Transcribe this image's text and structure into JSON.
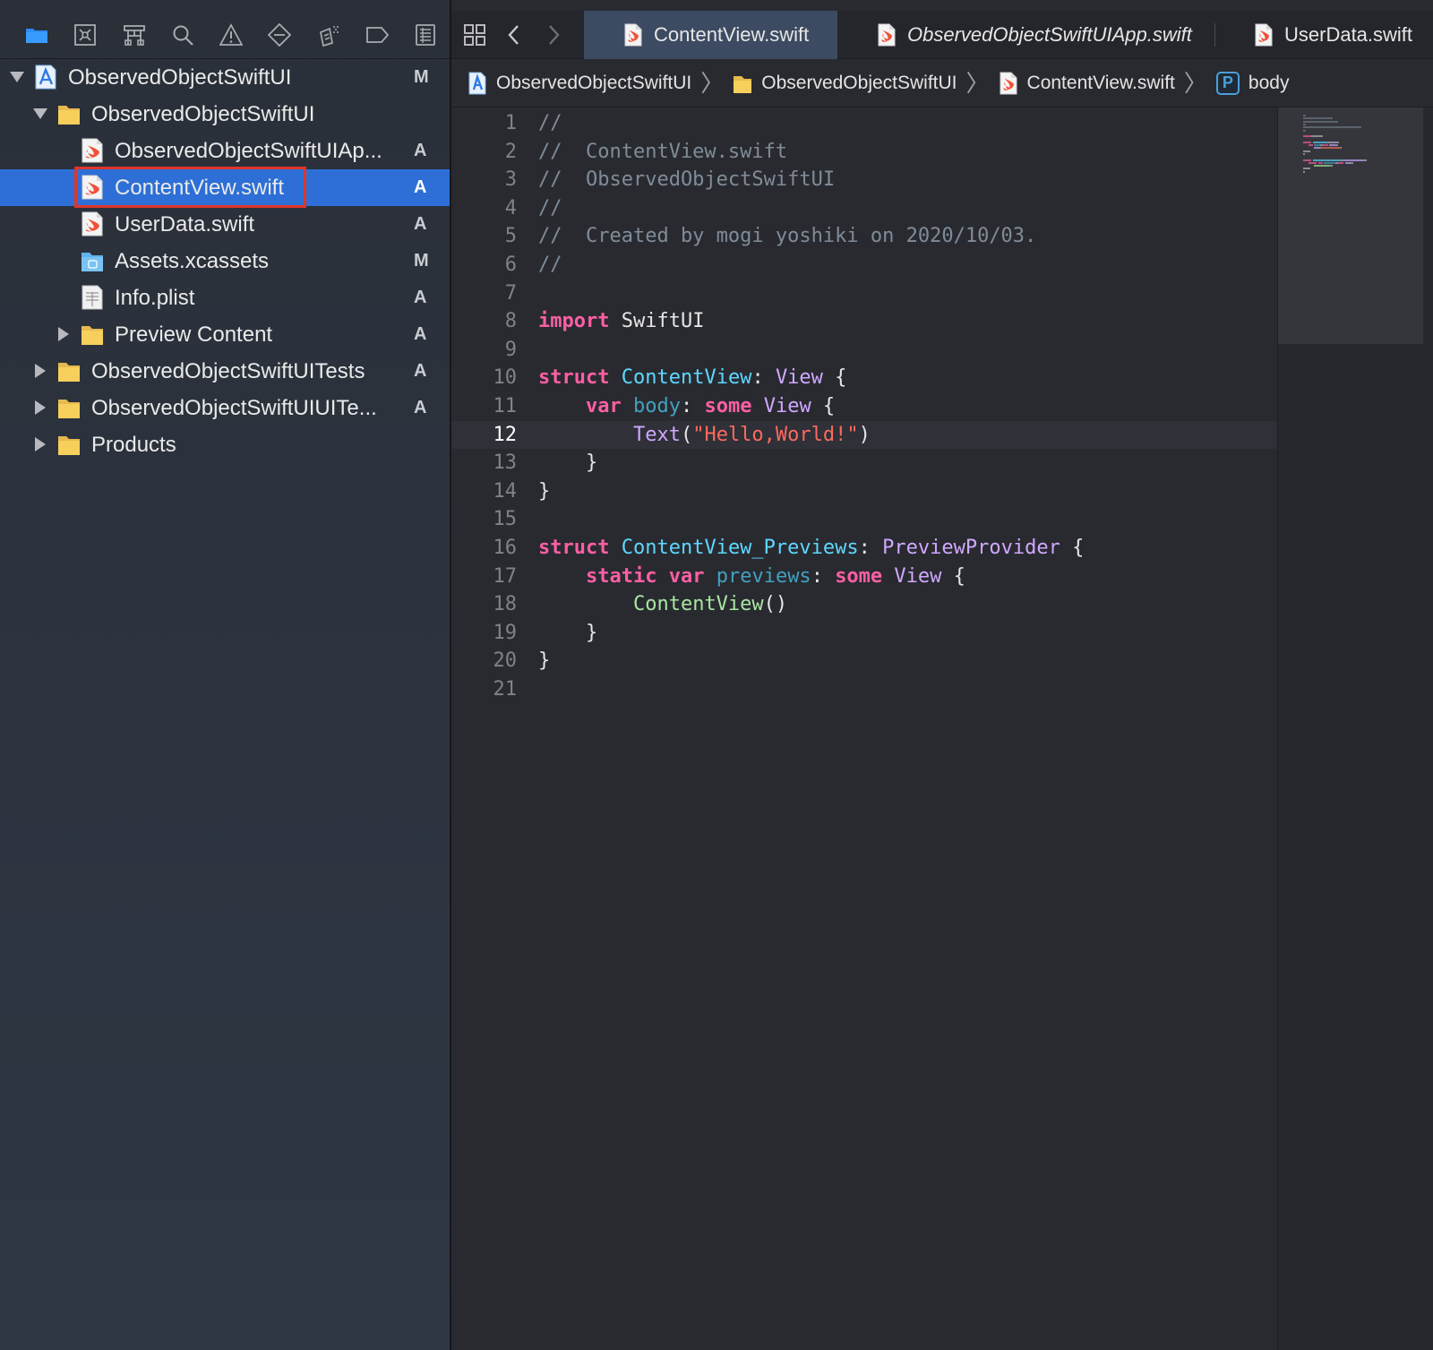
{
  "navigator": {
    "toolbar": [
      "project-navigator-icon",
      "source-control-icon",
      "symbol-navigator-icon",
      "find-icon",
      "issue-icon",
      "test-icon",
      "debug-icon",
      "breakpoint-icon",
      "report-icon"
    ],
    "tree": [
      {
        "label": "ObservedObjectSwiftUI",
        "status": "M",
        "type": "project",
        "indent": 0,
        "disclosure": "open"
      },
      {
        "label": "ObservedObjectSwiftUI",
        "status": "",
        "type": "folder",
        "indent": 1,
        "disclosure": "open"
      },
      {
        "label": "ObservedObjectSwiftUIAp...",
        "status": "A",
        "type": "swift",
        "indent": 2,
        "disclosure": "none"
      },
      {
        "label": "ContentView.swift",
        "status": "A",
        "type": "swift",
        "indent": 2,
        "disclosure": "none",
        "selected": true
      },
      {
        "label": "UserData.swift",
        "status": "A",
        "type": "swift",
        "indent": 2,
        "disclosure": "none"
      },
      {
        "label": "Assets.xcassets",
        "status": "M",
        "type": "assets",
        "indent": 2,
        "disclosure": "none"
      },
      {
        "label": "Info.plist",
        "status": "A",
        "type": "plist",
        "indent": 2,
        "disclosure": "none"
      },
      {
        "label": "Preview Content",
        "status": "A",
        "type": "folder",
        "indent": 2,
        "disclosure": "closed"
      },
      {
        "label": "ObservedObjectSwiftUITests",
        "status": "A",
        "type": "folder",
        "indent": 1,
        "disclosure": "closed"
      },
      {
        "label": "ObservedObjectSwiftUIUITe...",
        "status": "A",
        "type": "folder",
        "indent": 1,
        "disclosure": "closed"
      },
      {
        "label": "Products",
        "status": "",
        "type": "folder",
        "indent": 1,
        "disclosure": "closed"
      }
    ]
  },
  "tabs": [
    {
      "label": "ContentView.swift",
      "active": true,
      "italic": false
    },
    {
      "label": "ObservedObjectSwiftUIApp.swift",
      "active": false,
      "italic": true
    },
    {
      "label": "UserData.swift",
      "active": false,
      "italic": false
    }
  ],
  "breadcrumb": [
    {
      "label": "ObservedObjectSwiftUI",
      "icon": "project-icon"
    },
    {
      "label": "ObservedObjectSwiftUI",
      "icon": "folder-icon"
    },
    {
      "label": "ContentView.swift",
      "icon": "swift-file-icon"
    },
    {
      "label": "body",
      "icon": "property-icon",
      "badge": "P"
    }
  ],
  "editor": {
    "current_line": 12,
    "lines": [
      [
        [
          "cm",
          "//"
        ]
      ],
      [
        [
          "cm",
          "//  ContentView.swift"
        ]
      ],
      [
        [
          "cm",
          "//  ObservedObjectSwiftUI"
        ]
      ],
      [
        [
          "cm",
          "//"
        ]
      ],
      [
        [
          "cm",
          "//  Created by mogi yoshiki on 2020/10/03."
        ]
      ],
      [
        [
          "cm",
          "//"
        ]
      ],
      [],
      [
        [
          "kw",
          "import"
        ],
        [
          "",
          " SwiftUI"
        ]
      ],
      [],
      [
        [
          "kw",
          "struct"
        ],
        [
          "",
          " "
        ],
        [
          "ty",
          "ContentView"
        ],
        [
          "",
          ": "
        ],
        [
          "st",
          "View"
        ],
        [
          "",
          " {"
        ]
      ],
      [
        [
          "",
          "    "
        ],
        [
          "kw",
          "var"
        ],
        [
          "",
          " "
        ],
        [
          "pr",
          "body"
        ],
        [
          "",
          ": "
        ],
        [
          "kw",
          "some"
        ],
        [
          "",
          " "
        ],
        [
          "st",
          "View"
        ],
        [
          "",
          " {"
        ]
      ],
      [
        [
          "",
          "        "
        ],
        [
          "fn",
          "Text"
        ],
        [
          "",
          "("
        ],
        [
          "str",
          "\"Hello,World!\""
        ],
        [
          "",
          ")"
        ]
      ],
      [
        [
          "",
          "    }"
        ]
      ],
      [
        [
          "",
          "}"
        ]
      ],
      [],
      [
        [
          "kw",
          "struct"
        ],
        [
          "",
          " "
        ],
        [
          "ty",
          "ContentView_Previews"
        ],
        [
          "",
          ": "
        ],
        [
          "st",
          "PreviewProvider"
        ],
        [
          "",
          " {"
        ]
      ],
      [
        [
          "",
          "    "
        ],
        [
          "kw",
          "static"
        ],
        [
          "",
          " "
        ],
        [
          "kw",
          "var"
        ],
        [
          "",
          " "
        ],
        [
          "pr",
          "previews"
        ],
        [
          "",
          ": "
        ],
        [
          "kw",
          "some"
        ],
        [
          "",
          " "
        ],
        [
          "st",
          "View"
        ],
        [
          "",
          " {"
        ]
      ],
      [
        [
          "",
          "        "
        ],
        [
          "cv",
          "ContentView"
        ],
        [
          "",
          "()"
        ]
      ],
      [
        [
          "",
          "    }"
        ]
      ],
      [
        [
          "",
          "}"
        ]
      ],
      []
    ]
  }
}
